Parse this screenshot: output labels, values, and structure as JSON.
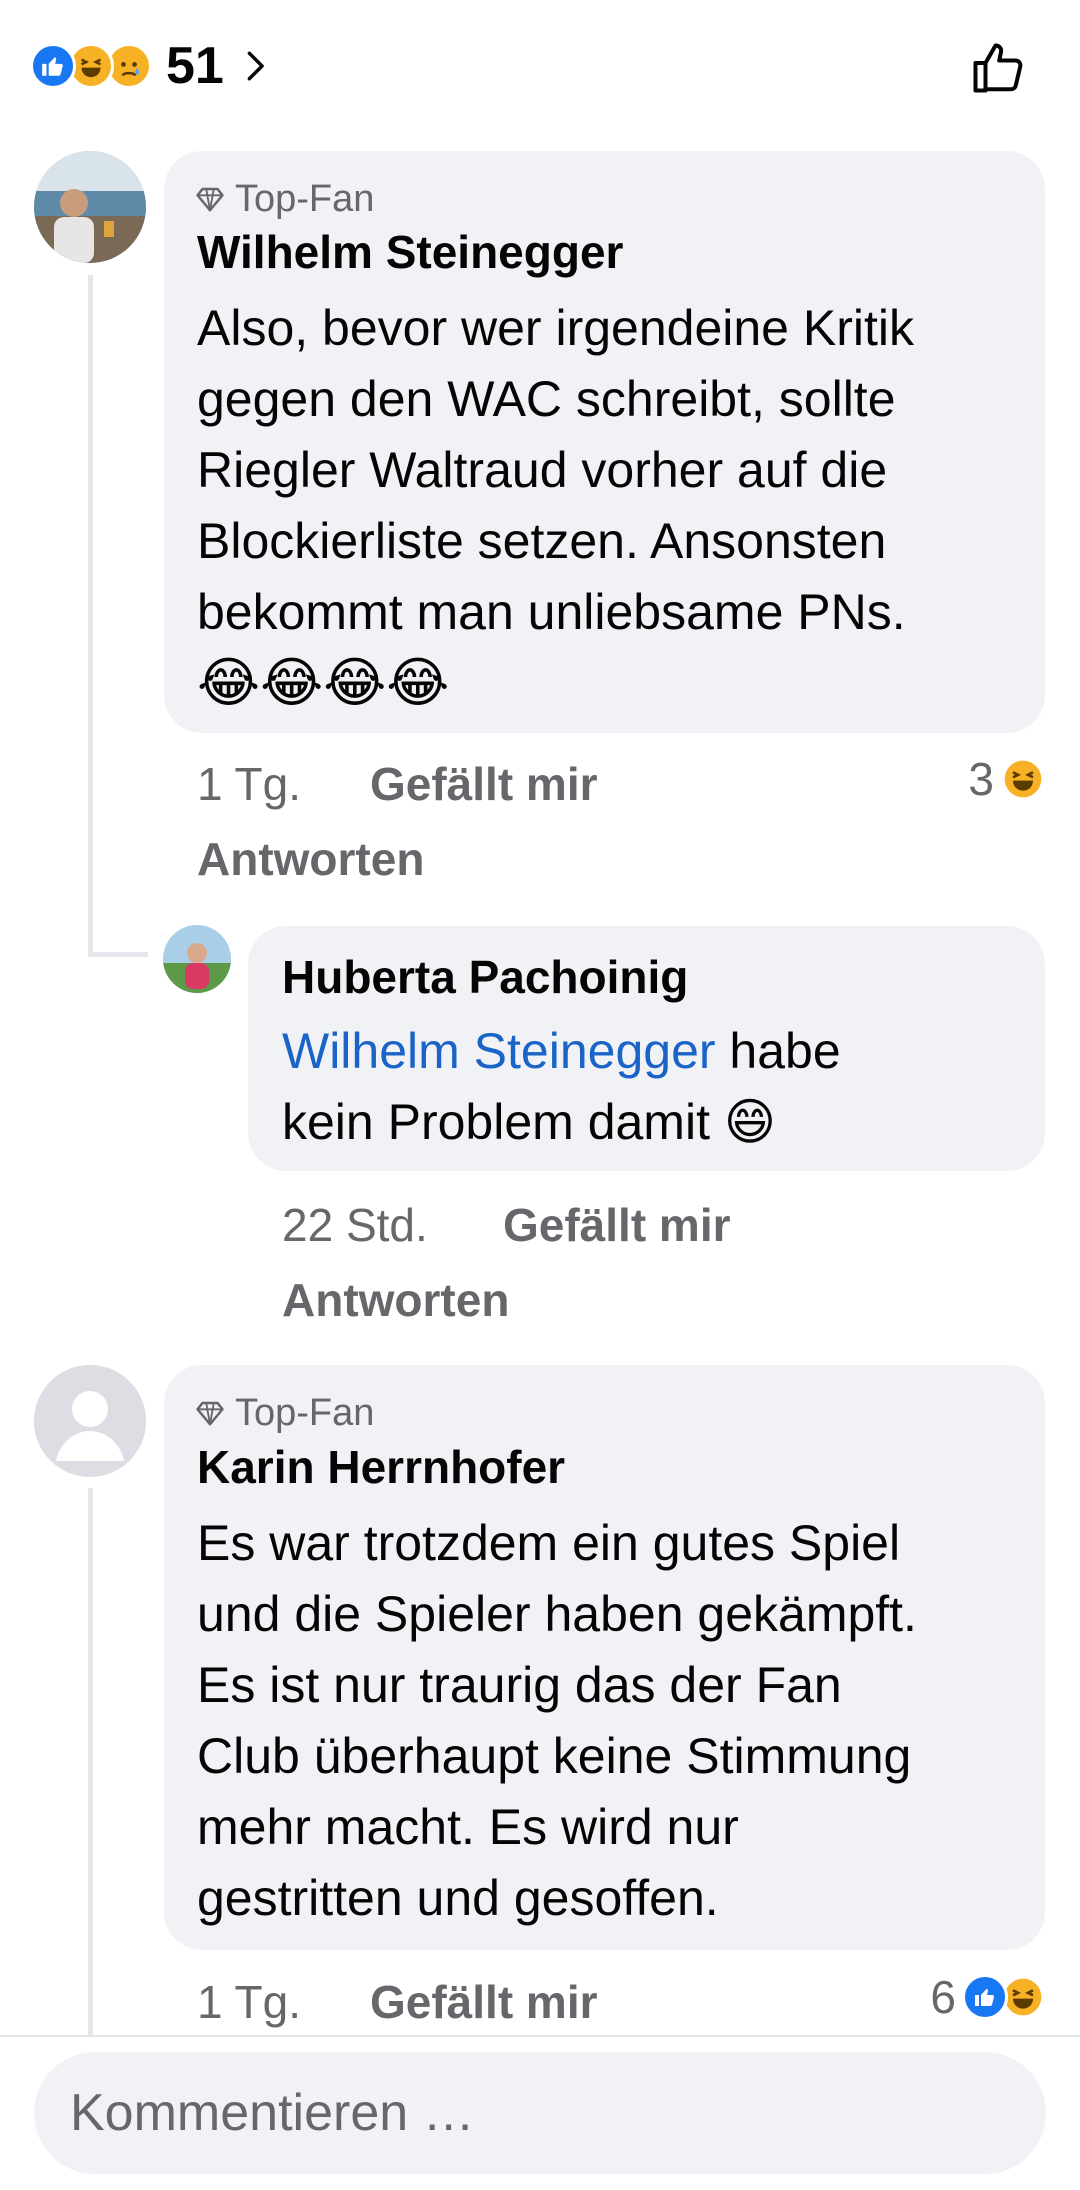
{
  "header": {
    "reaction_count": "51",
    "reaction_icons": [
      "like-icon",
      "haha-icon",
      "sad-icon"
    ]
  },
  "comments": [
    {
      "badge": "Top-Fan",
      "author": "Wilhelm Steinegger",
      "text_lines": [
        "Also, bevor wer irgendeine Kritik",
        "gegen den WAC schreibt, sollte",
        "Riegler Waltraud vorher auf die",
        "Blockierliste setzen. Ansonsten",
        "bekommt man unliebsame PNs."
      ],
      "emoji_line": "😂😂😂😂",
      "time": "1 Tg.",
      "like_label": "Gefällt mir",
      "reply_label": "Antworten",
      "reaction_count": "3"
    },
    {
      "author": "Huberta Pachoinig",
      "mention": "Wilhelm Steinegger",
      "text_after_mention": " habe",
      "text_line2": "kein Problem damit 😄",
      "time": "22 Std.",
      "like_label": "Gefällt mir",
      "reply_label": "Antworten"
    },
    {
      "badge": "Top-Fan",
      "author": "Karin Herrnhofer",
      "text_lines": [
        "Es war trotzdem ein gutes Spiel",
        "und die Spieler haben gekämpft.",
        "Es ist nur traurig das der Fan",
        "Club überhaupt keine Stimmung",
        "mehr macht. Es wird nur",
        "gestritten und gesoffen."
      ],
      "time": "1 Tg.",
      "like_label": "Gefällt mir",
      "reaction_count": "6"
    }
  ],
  "composer": {
    "placeholder": "Kommentieren …"
  },
  "colors": {
    "accent": "#1877f2",
    "mention": "#1b64c7",
    "bubble": "#f0f2f5",
    "meta": "#65676b"
  }
}
